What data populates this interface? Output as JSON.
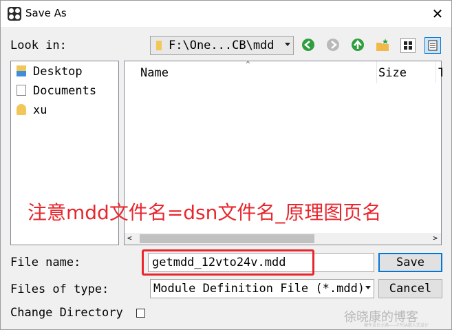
{
  "window": {
    "title": "Save As",
    "close_glyph": "✕"
  },
  "look_in": {
    "label": "Look in:",
    "path": "F:\\One...CB\\mdd"
  },
  "toolbar": {
    "icons": [
      "back-icon",
      "forward-icon",
      "up-folder-icon",
      "new-folder-icon",
      "view-icons-icon",
      "view-details-icon"
    ]
  },
  "places": [
    {
      "label": "Desktop",
      "icon": "desktop-icon"
    },
    {
      "label": "Documents",
      "icon": "documents-icon"
    },
    {
      "label": "xu",
      "icon": "user-icon"
    }
  ],
  "file_list": {
    "columns": [
      "Name",
      "Size",
      "T"
    ]
  },
  "annotation": {
    "text": "注意mdd文件名=dsn文件名_原理图页名",
    "color": "#e8262d"
  },
  "file_name": {
    "label": "File name:",
    "value": "getmdd_12vto24v.mdd"
  },
  "save_button": {
    "label": "Save"
  },
  "file_type": {
    "label": "Files of type:",
    "value": "Module Definition File (*.mdd)"
  },
  "cancel_button": {
    "label": "Cancel"
  },
  "change_directory": {
    "label": "Change Directory",
    "checked": false
  },
  "watermark": {
    "text": "徐晓康的博客",
    "subtext": "硬件设计之路——FPGA嵌入式设计"
  },
  "colors": {
    "accent": "#0078d7",
    "highlight": "#e8262d"
  }
}
